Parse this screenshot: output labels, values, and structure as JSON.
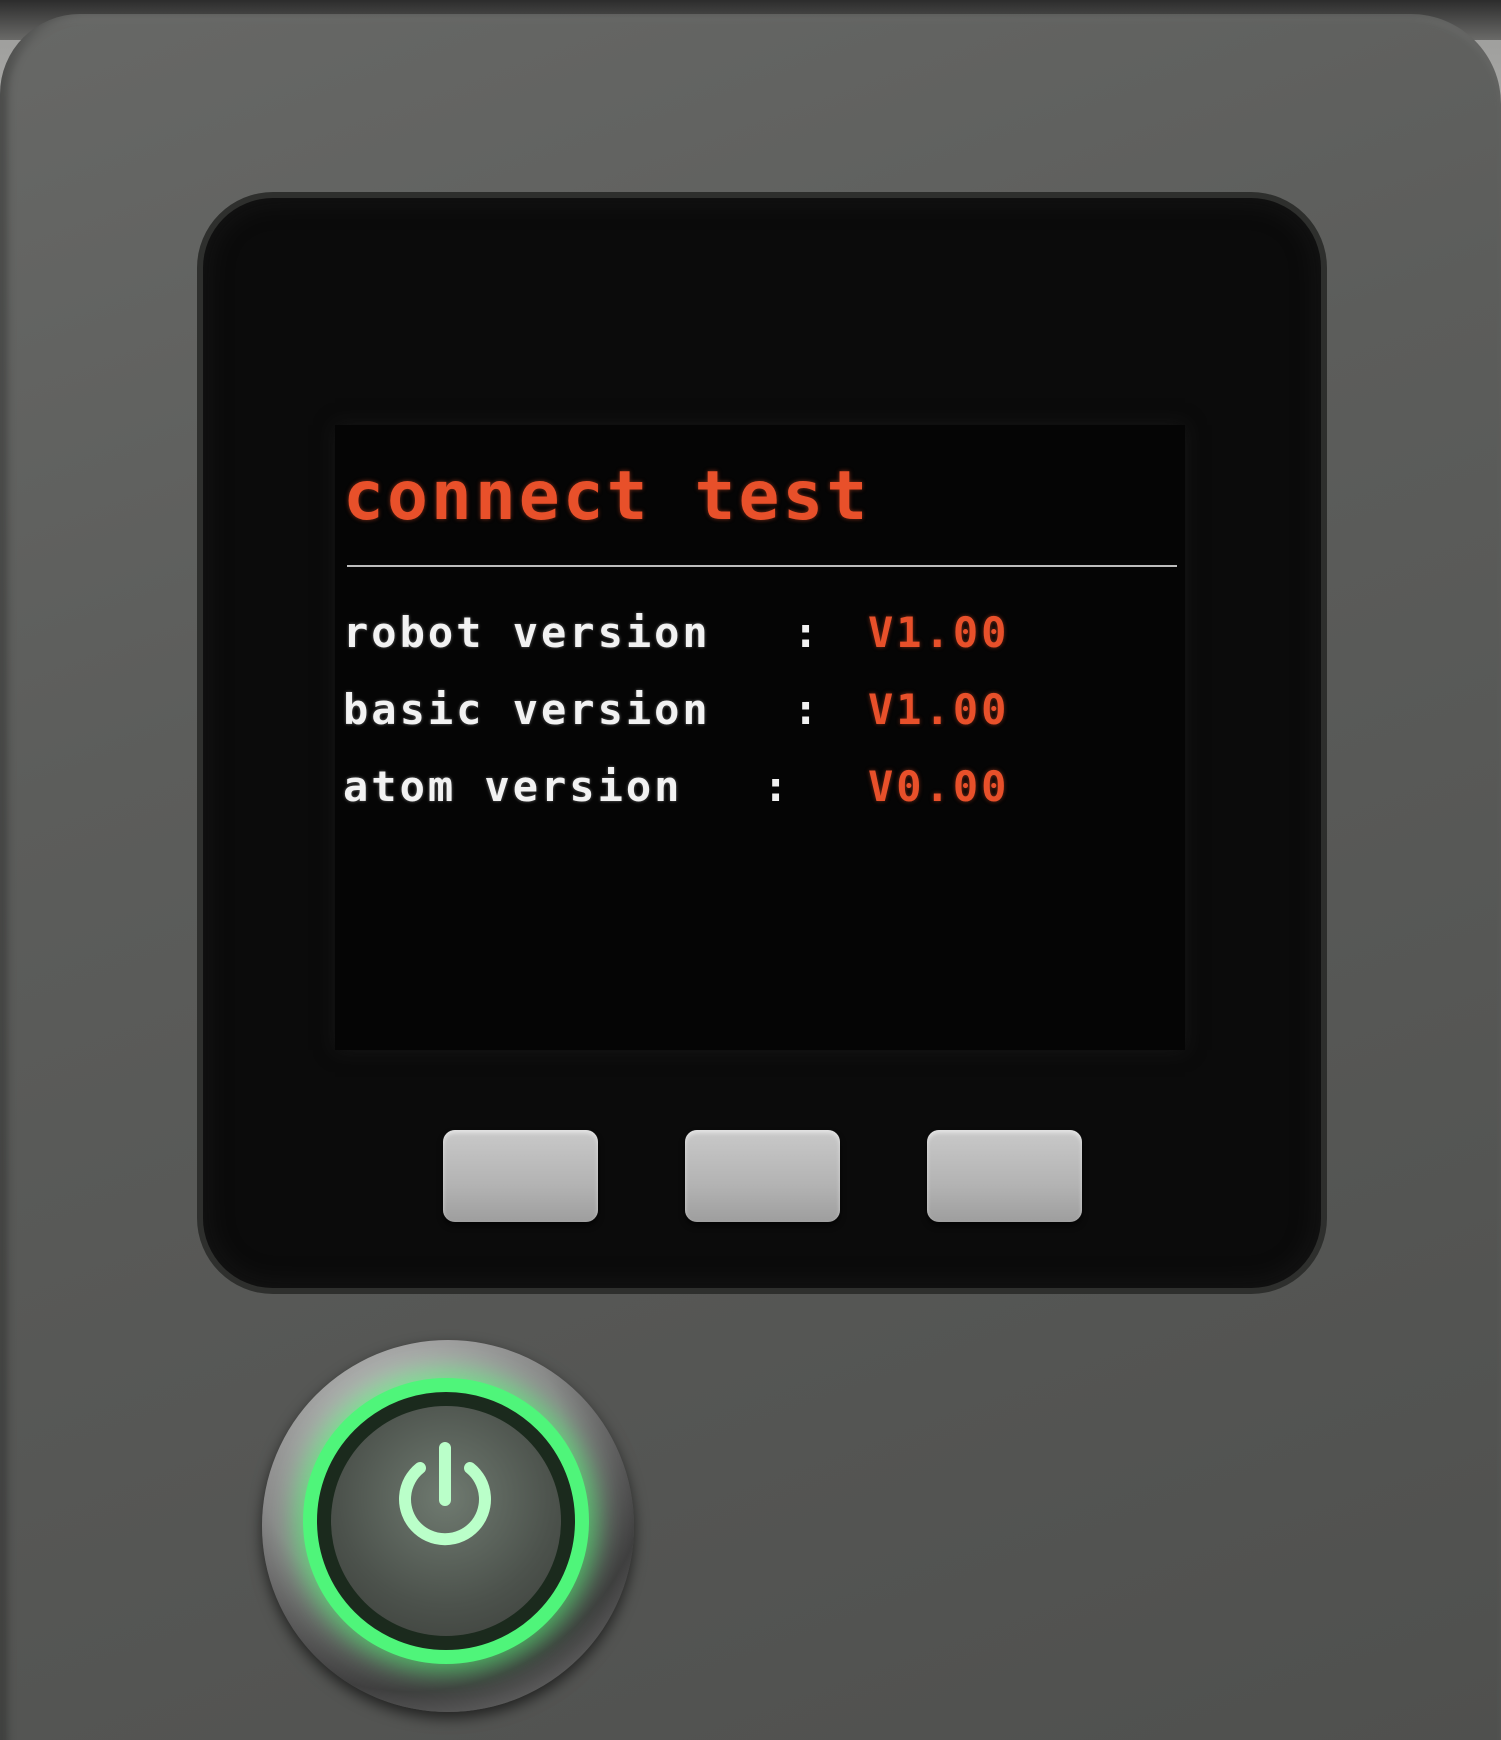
{
  "device": {
    "screen": {
      "title": "connect test",
      "rows": [
        {
          "label": "robot version",
          "colon": ":",
          "value": "V1.00"
        },
        {
          "label": "basic version",
          "colon": ":",
          "value": "V1.00"
        },
        {
          "label": "atom version",
          "colon": ":",
          "value": "V0.00"
        }
      ]
    },
    "buttons": [
      "button-a",
      "button-b",
      "button-c"
    ],
    "power_button": {
      "icon": "power-icon",
      "light_color": "#4ff57a"
    }
  },
  "colors": {
    "accent_text": "#e8502a",
    "plain_text": "#f2f2f2",
    "screen_bg": "#050505",
    "housing": "#5c5d5b"
  }
}
